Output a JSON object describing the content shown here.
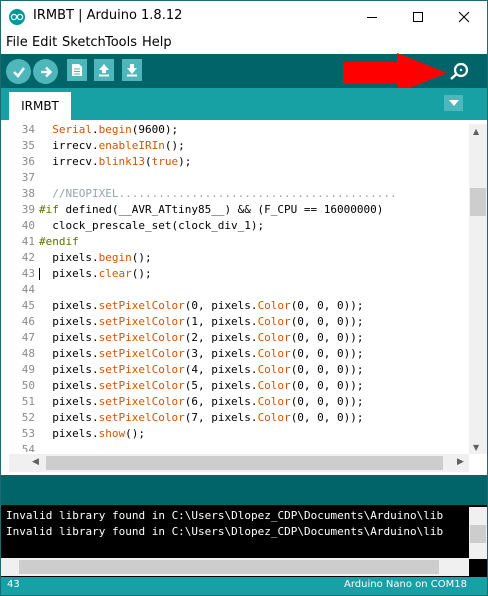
{
  "window": {
    "title": "IRMBT | Arduino 1.8.12",
    "controls": {
      "minimize": "─",
      "maximize": "☐",
      "close": "✕"
    }
  },
  "menu": [
    "File",
    "Edit",
    "Sketch",
    "Tools",
    "Help"
  ],
  "toolbar": {
    "buttons": [
      "verify-icon",
      "upload-icon",
      "new-icon",
      "open-icon",
      "save-icon"
    ],
    "serial_monitor": "magnifier-icon"
  },
  "tabs": {
    "active": "IRMBT"
  },
  "editor": {
    "lines": [
      {
        "n": "34",
        "segs": [
          [
            "",
            "  "
          ],
          [
            "kw",
            "Serial"
          ],
          [
            "",
            "."
          ],
          [
            "fn",
            "begin"
          ],
          [
            "",
            "(9600);"
          ]
        ]
      },
      {
        "n": "35",
        "segs": [
          [
            "",
            "  irrecv."
          ],
          [
            "fn",
            "enableIRIn"
          ],
          [
            "",
            "();"
          ]
        ]
      },
      {
        "n": "36",
        "segs": [
          [
            "",
            "  irrecv."
          ],
          [
            "fn",
            "blink13"
          ],
          [
            "",
            "("
          ],
          [
            "kw",
            "true"
          ],
          [
            "",
            ");"
          ]
        ]
      },
      {
        "n": "37",
        "segs": [
          [
            "",
            ""
          ]
        ]
      },
      {
        "n": "38",
        "segs": [
          [
            "cm",
            "  //NEOPIXEL.........................................."
          ]
        ]
      },
      {
        "n": "39",
        "segs": [
          [
            "pp",
            "#if"
          ],
          [
            "",
            " defined(__AVR_ATtiny85__) && (F_CPU == 16000000)"
          ]
        ]
      },
      {
        "n": "40",
        "segs": [
          [
            "",
            "  clock_prescale_set(clock_div_1);"
          ]
        ]
      },
      {
        "n": "41",
        "segs": [
          [
            "pp",
            "#endif"
          ]
        ]
      },
      {
        "n": "42",
        "segs": [
          [
            "",
            "  pixels."
          ],
          [
            "fn",
            "begin"
          ],
          [
            "",
            "();"
          ]
        ]
      },
      {
        "n": "43",
        "segs": [
          [
            "",
            "  pixels."
          ],
          [
            "fn",
            "clear"
          ],
          [
            "",
            "();"
          ]
        ]
      },
      {
        "n": "44",
        "segs": [
          [
            "",
            ""
          ]
        ]
      },
      {
        "n": "45",
        "segs": [
          [
            "",
            "  pixels."
          ],
          [
            "fn",
            "setPixelColor"
          ],
          [
            "",
            "(0, pixels."
          ],
          [
            "fn",
            "Color"
          ],
          [
            "",
            "(0, 0, 0));"
          ]
        ]
      },
      {
        "n": "46",
        "segs": [
          [
            "",
            "  pixels."
          ],
          [
            "fn",
            "setPixelColor"
          ],
          [
            "",
            "(1, pixels."
          ],
          [
            "fn",
            "Color"
          ],
          [
            "",
            "(0, 0, 0));"
          ]
        ]
      },
      {
        "n": "47",
        "segs": [
          [
            "",
            "  pixels."
          ],
          [
            "fn",
            "setPixelColor"
          ],
          [
            "",
            "(2, pixels."
          ],
          [
            "fn",
            "Color"
          ],
          [
            "",
            "(0, 0, 0));"
          ]
        ]
      },
      {
        "n": "48",
        "segs": [
          [
            "",
            "  pixels."
          ],
          [
            "fn",
            "setPixelColor"
          ],
          [
            "",
            "(3, pixels."
          ],
          [
            "fn",
            "Color"
          ],
          [
            "",
            "(0, 0, 0));"
          ]
        ]
      },
      {
        "n": "49",
        "segs": [
          [
            "",
            "  pixels."
          ],
          [
            "fn",
            "setPixelColor"
          ],
          [
            "",
            "(4, pixels."
          ],
          [
            "fn",
            "Color"
          ],
          [
            "",
            "(0, 0, 0));"
          ]
        ]
      },
      {
        "n": "50",
        "segs": [
          [
            "",
            "  pixels."
          ],
          [
            "fn",
            "setPixelColor"
          ],
          [
            "",
            "(5, pixels."
          ],
          [
            "fn",
            "Color"
          ],
          [
            "",
            "(0, 0, 0));"
          ]
        ]
      },
      {
        "n": "51",
        "segs": [
          [
            "",
            "  pixels."
          ],
          [
            "fn",
            "setPixelColor"
          ],
          [
            "",
            "(6, pixels."
          ],
          [
            "fn",
            "Color"
          ],
          [
            "",
            "(0, 0, 0));"
          ]
        ]
      },
      {
        "n": "52",
        "segs": [
          [
            "",
            "  pixels."
          ],
          [
            "fn",
            "setPixelColor"
          ],
          [
            "",
            "(7, pixels."
          ],
          [
            "fn",
            "Color"
          ],
          [
            "",
            "(0, 0, 0));"
          ]
        ]
      },
      {
        "n": "53",
        "segs": [
          [
            "",
            "  pixels."
          ],
          [
            "fn",
            "show"
          ],
          [
            "",
            "();"
          ]
        ]
      },
      {
        "n": "54",
        "segs": [
          [
            "",
            ""
          ]
        ]
      }
    ],
    "cursor_line": "43"
  },
  "console": {
    "lines": [
      "Invalid library found in C:\\Users\\Dlopez_CDP\\Documents\\Arduino\\lib",
      "Invalid library found in C:\\Users\\Dlopez_CDP\\Documents\\Arduino\\lib"
    ]
  },
  "status": {
    "line": "43",
    "board": "Arduino Nano on COM18"
  },
  "colors": {
    "teal_dark": "#006468",
    "teal_tab": "#17a1a5",
    "button": "#4db7bb",
    "keyword": "#d35400",
    "preprocessor": "#5e6d03",
    "comment": "#95a5a6",
    "annotation_arrow": "#ff0000"
  }
}
